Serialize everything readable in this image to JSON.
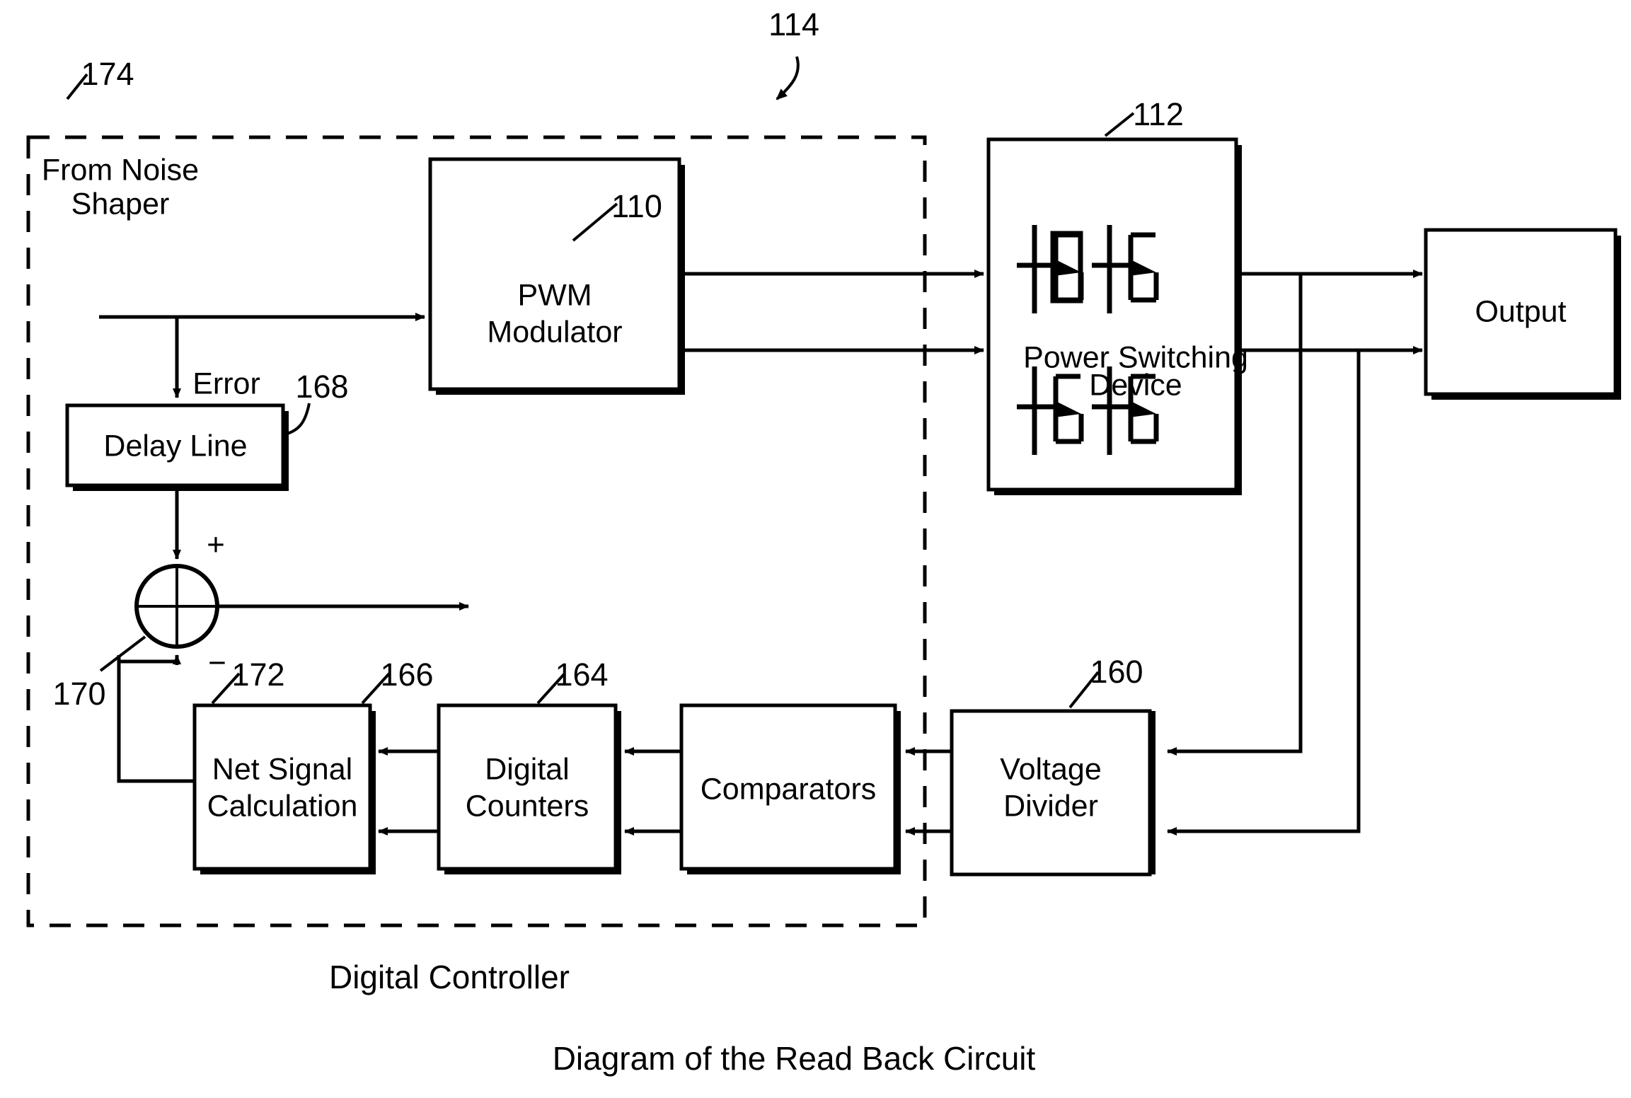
{
  "figure": {
    "caption": "Diagram of the Read Back Circuit",
    "enclosure_label": "Digital Controller"
  },
  "reference_numerals": {
    "system": "114",
    "controller_boundary": "174",
    "pwm_modulator": "110",
    "delay_line": "168",
    "summing_junction": "170",
    "net_signal_calculation": "172",
    "digital_counters": "166",
    "comparators": "164",
    "voltage_divider": "160",
    "power_switching_device": "112"
  },
  "blocks": [
    {
      "id": "pwm",
      "label_line1": "PWM",
      "label_line2": "Modulator",
      "ref": "110"
    },
    {
      "id": "delay",
      "label_line1": "Delay Line",
      "label_line2": "",
      "ref": "168"
    },
    {
      "id": "net_signal",
      "label_line1": "Net Signal",
      "label_line2": "Calculation",
      "ref": "172"
    },
    {
      "id": "counters",
      "label_line1": "Digital",
      "label_line2": "Counters",
      "ref": "166"
    },
    {
      "id": "comparators",
      "label_line1": "Comparators",
      "label_line2": "",
      "ref": "164"
    },
    {
      "id": "divider",
      "label_line1": "Voltage",
      "label_line2": "Divider",
      "ref": "160"
    },
    {
      "id": "power_switch",
      "label_line1": "",
      "label_line2": "",
      "ref": "112"
    },
    {
      "id": "output",
      "label_line1": "Output",
      "label_line2": "",
      "ref": ""
    }
  ],
  "free_text": {
    "source_line1": "From Noise",
    "source_line2": "Shaper",
    "error_signal": "Error",
    "power_switch_line1": "Power Switching",
    "power_switch_line2": "Device",
    "output_block": "Output",
    "plus_sign": "+",
    "minus_sign": "−"
  },
  "colors": {
    "line": "#000000",
    "background": "#ffffff"
  }
}
